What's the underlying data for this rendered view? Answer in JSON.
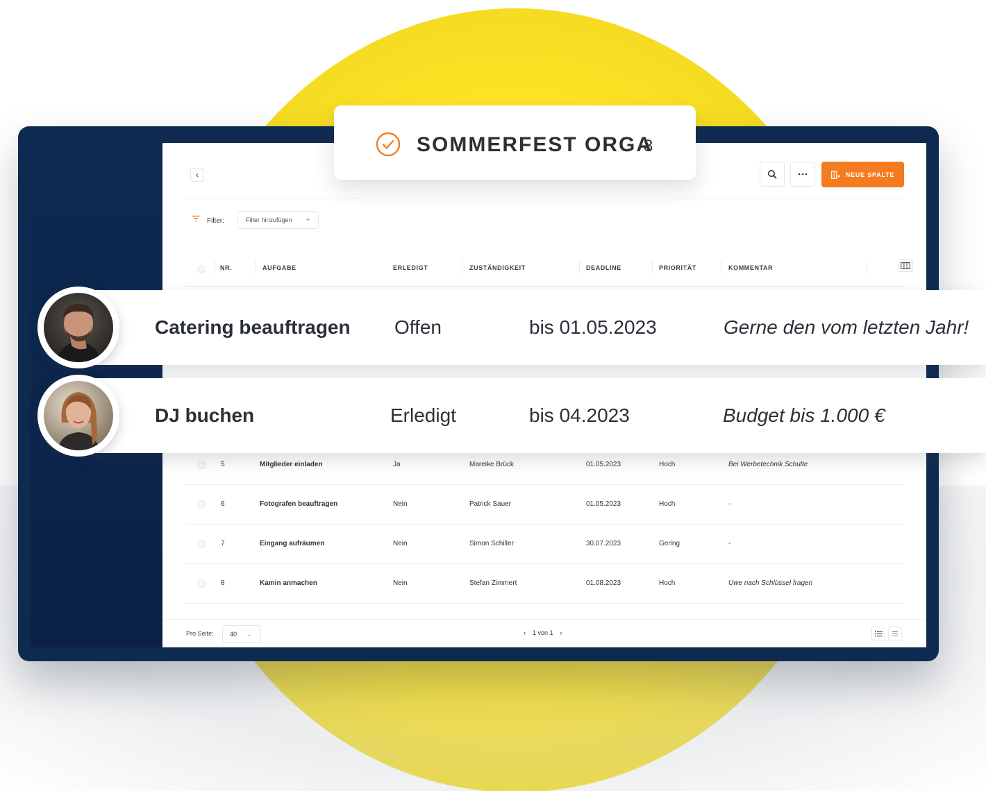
{
  "title_card": {
    "title": "SOMMERFEST ORGA",
    "count": "8"
  },
  "toolbar": {
    "new_column_label": "NEUE SPALTE"
  },
  "filter": {
    "label": "Filter:",
    "add_label": "Filter hinzufügen",
    "add_symbol": "+"
  },
  "table": {
    "headers": [
      "NR.",
      "AUFGABE",
      "ERLEDIGT",
      "ZUSTÄNDIGKEIT",
      "DEADLINE",
      "PRIORITÄT",
      "KOMMENTAR"
    ],
    "rows": [
      {
        "nr": "5",
        "task": "Mitglieder einladen",
        "done": "Ja",
        "owner": "Mareike Brück",
        "deadline": "01.05.2023",
        "priority": "Hoch",
        "comment": "Bei Werbetechnik Schulte"
      },
      {
        "nr": "6",
        "task": "Fotografen beauftragen",
        "done": "Nein",
        "owner": "Patrick Sauer",
        "deadline": "01.05.2023",
        "priority": "Hoch",
        "comment": "-"
      },
      {
        "nr": "7",
        "task": "Eingang aufräumen",
        "done": "Nein",
        "owner": "Simon Schiller",
        "deadline": "30.07.2023",
        "priority": "Gering",
        "comment": "-"
      },
      {
        "nr": "8",
        "task": "Kamin anmachen",
        "done": "Nein",
        "owner": "Stefan Zimmert",
        "deadline": "01.08.2023",
        "priority": "Hoch",
        "comment": "Uwe nach Schlüssel fragen"
      }
    ]
  },
  "highlights": [
    {
      "task": "Catering beauftragen",
      "status": "Offen",
      "deadline": "bis 01.05.2023",
      "comment": "Gerne den vom letzten Jahr!"
    },
    {
      "task": "DJ buchen",
      "status": "Erledigt",
      "deadline": "bis 04.2023",
      "comment": "Budget bis 1.000 €"
    }
  ],
  "footer": {
    "per_page_label": "Pro Seite:",
    "per_page_value": "40",
    "pagination": "1 von 1"
  },
  "colors": {
    "accent": "#f47b20",
    "frame": "#0f2a50",
    "yellow": "#fce324"
  },
  "icons": [
    "chevron-left-icon",
    "search-icon",
    "more-icon",
    "add-column-icon",
    "filter-icon",
    "plus-icon",
    "columns-icon",
    "check-circle-icon",
    "chevron-down-icon",
    "list-view-icon",
    "compact-view-icon"
  ]
}
